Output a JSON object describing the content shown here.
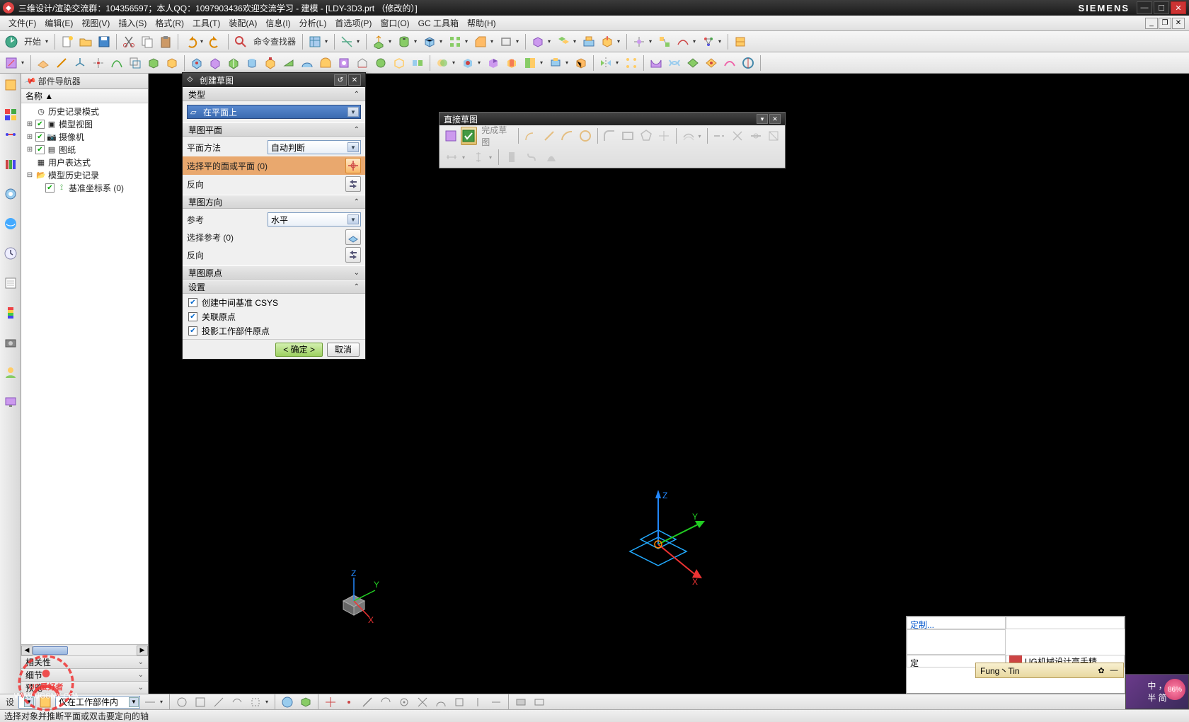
{
  "title": "三维设计/渲染交流群：104356597；本人QQ：1097903436欢迎交流学习 - 建模 - [LDY-3D3.prt （修改的）]",
  "brand": "SIEMENS",
  "menubar": [
    "文件(F)",
    "编辑(E)",
    "视图(V)",
    "插入(S)",
    "格式(R)",
    "工具(T)",
    "装配(A)",
    "信息(I)",
    "分析(L)",
    "首选项(P)",
    "窗口(O)",
    "GC 工具箱",
    "帮助(H)"
  ],
  "toolbar1": {
    "start": "开始",
    "cmdfinder": "命令查找器"
  },
  "nav": {
    "header": "部件导航器",
    "col": "名称 ▲",
    "items": [
      {
        "indent": 0,
        "toggle": "",
        "check": "",
        "icon": "◷",
        "label": "历史记录模式"
      },
      {
        "indent": 0,
        "toggle": "+",
        "check": "✔",
        "icon": "▣",
        "label": "模型视图"
      },
      {
        "indent": 0,
        "toggle": "+",
        "check": "✔",
        "icon": "📷",
        "label": "摄像机"
      },
      {
        "indent": 0,
        "toggle": "+",
        "check": "✔",
        "icon": "▤",
        "label": "图纸"
      },
      {
        "indent": 0,
        "toggle": "",
        "check": "",
        "icon": "▦",
        "label": "用户表达式"
      },
      {
        "indent": 0,
        "toggle": "−",
        "check": "",
        "icon": "📁",
        "label": "模型历史记录"
      },
      {
        "indent": 1,
        "toggle": "",
        "check": "✔",
        "icon": "⟟",
        "label": "基准坐标系 (0)"
      }
    ],
    "collapse": [
      "相关性",
      "细节",
      "预览"
    ]
  },
  "dialog": {
    "title": "创建草图",
    "sections": {
      "type": "类型",
      "type_sel": "在平面上",
      "plane": "草图平面",
      "plane_method": "平面方法",
      "plane_method_val": "自动判断",
      "select_face": "选择平的面或平面 (0)",
      "reverse": "反向",
      "orient": "草图方向",
      "ref": "参考",
      "ref_val": "水平",
      "select_ref": "选择参考 (0)",
      "origin": "草图原点",
      "settings": "设置",
      "chk1": "创建中间基准 CSYS",
      "chk2": "关联原点",
      "chk3": "投影工作部件原点"
    },
    "ok": "< 确定 >",
    "cancel": "取消"
  },
  "float_tb": {
    "title": "直接草图",
    "finish": "完成草图"
  },
  "rb": {
    "customize": "定制...",
    "dz": "定",
    "music_title": "UG机械设计高手精"
  },
  "music": {
    "title": "Fung丶Tin"
  },
  "ime": {
    "l1": "中 ，",
    "l2": "半 简",
    "pct": "86%"
  },
  "bottom": {
    "sel_left": "设",
    "sel_label": "仅在工作部件内"
  },
  "status": "选择对象并推断平面或双击要定向的轴"
}
